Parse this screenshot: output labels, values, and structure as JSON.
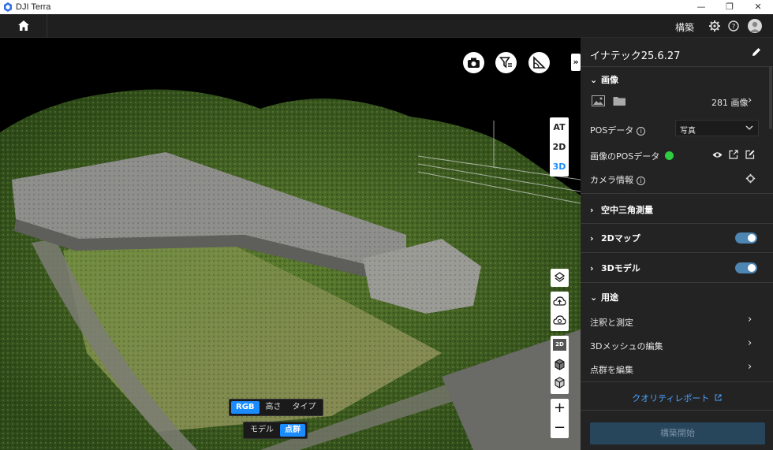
{
  "app": {
    "title": "DJI Terra",
    "window_controls": {
      "minimize": "—",
      "maximize": "❐",
      "close": "✕"
    }
  },
  "topbar": {
    "build_label": "構築",
    "icons": [
      "home-icon",
      "gear-icon",
      "help-icon",
      "user-avatar-icon"
    ]
  },
  "viewport": {
    "tools": [
      "camera-icon",
      "filter-icon",
      "measure-angle-icon"
    ],
    "collapse_label": "»",
    "view_modes": [
      "AT",
      "2D",
      "3D"
    ],
    "active_view_mode": "3D",
    "color_mode": {
      "options": [
        "RGB",
        "高さ",
        "タイプ"
      ],
      "selected": "RGB"
    },
    "display_mode": {
      "options": [
        "モデル",
        "点群"
      ],
      "selected": "点群"
    },
    "zoom_in": "+",
    "zoom_out": "−",
    "mini_label_2d": "2D"
  },
  "panel": {
    "project_title": "イナテック25.6.27",
    "images_section": {
      "title": "画像",
      "count_text": "281 画像",
      "pos_data_label": "POSデータ",
      "pos_data_value": "写真",
      "image_pos_label": "画像のPOSデータ",
      "camera_info_label": "カメラ情報"
    },
    "sections": {
      "aerial_triangulation": "空中三角測量",
      "map_2d": "2Dマップ",
      "model_3d": "3Dモデル",
      "usage": "用途"
    },
    "usage_items": [
      "注釈と測定",
      "3Dメッシュの編集",
      "点群を編集"
    ],
    "quality_report": "クオリティレポート",
    "start_button": "構築開始"
  },
  "colors": {
    "accent": "#1a8cff",
    "panel_bg": "#232323",
    "toggle_on": "#4e86b3",
    "status_ok": "#2ecc40",
    "start_button_bg": "#27465c"
  }
}
